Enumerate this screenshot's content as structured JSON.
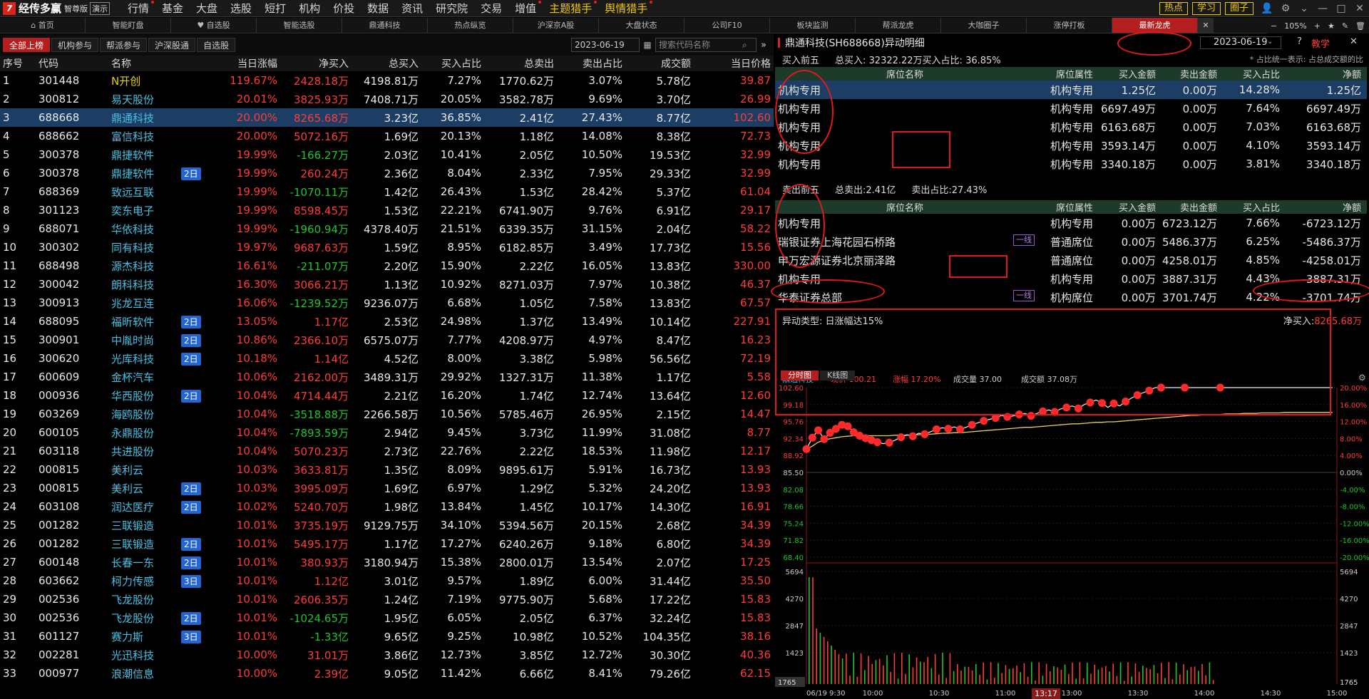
{
  "app": {
    "logo": "经传多赢",
    "edition": "智尊版",
    "demo": "演示"
  },
  "menu": [
    "行情",
    "基金",
    "大盘",
    "选股",
    "短打",
    "机构",
    "价投",
    "数据",
    "资讯",
    "研究院",
    "交易",
    "增值",
    "主题猎手",
    "舆情猎手"
  ],
  "top_right": {
    "hot": "热点",
    "learn": "学习",
    "circle": "圈子"
  },
  "tabs": [
    "首页",
    "智能盯盘",
    "自选股",
    "智能选股",
    "鼎通科技",
    "热点纵览",
    "沪深京A股",
    "大盘状态",
    "公司F10",
    "板块监测",
    "帮派龙虎",
    "大咖圈子",
    "涨停打板",
    "最新龙虎"
  ],
  "tab_ctl": {
    "zoom": "105%"
  },
  "filters": [
    "全部上榜",
    "机构参与",
    "帮派参与",
    "沪深股通",
    "自选股"
  ],
  "left_date": "2023-06-19",
  "search_placeholder": "搜索代码名称",
  "left_headers": [
    "序号",
    "代码",
    "名称",
    "",
    "当日涨幅",
    "净买入",
    "总买入",
    "买入占比",
    "总卖出",
    "卖出占比",
    "成交额",
    "当日价格"
  ],
  "rows": [
    [
      "1",
      "301448",
      "N开创",
      "",
      "119.67%",
      "2428.18万",
      "4198.81万",
      "7.27%",
      "1770.62万",
      "3.07%",
      "5.78亿",
      "39.87"
    ],
    [
      "2",
      "300812",
      "易天股份",
      "",
      "20.01%",
      "3825.93万",
      "7408.71万",
      "20.05%",
      "3582.78万",
      "9.69%",
      "3.70亿",
      "26.99"
    ],
    [
      "3",
      "688668",
      "鼎通科技",
      "",
      "20.00%",
      "8265.68万",
      "3.23亿",
      "36.85%",
      "2.41亿",
      "27.43%",
      "8.77亿",
      "102.60"
    ],
    [
      "4",
      "688662",
      "富信科技",
      "",
      "20.00%",
      "5072.16万",
      "1.69亿",
      "20.13%",
      "1.18亿",
      "14.08%",
      "8.38亿",
      "72.73"
    ],
    [
      "5",
      "300378",
      "鼎捷软件",
      "",
      "19.99%",
      "-166.27万",
      "2.03亿",
      "10.41%",
      "2.05亿",
      "10.50%",
      "19.53亿",
      "32.99"
    ],
    [
      "6",
      "300378",
      "鼎捷软件",
      "2日",
      "19.99%",
      "260.24万",
      "2.36亿",
      "8.04%",
      "2.33亿",
      "7.95%",
      "29.33亿",
      "32.99"
    ],
    [
      "7",
      "688369",
      "致远互联",
      "",
      "19.99%",
      "-1070.11万",
      "1.42亿",
      "26.43%",
      "1.53亿",
      "28.42%",
      "5.37亿",
      "61.04"
    ],
    [
      "8",
      "301123",
      "奕东电子",
      "",
      "19.99%",
      "8598.45万",
      "1.53亿",
      "22.21%",
      "6741.90万",
      "9.76%",
      "6.91亿",
      "29.17"
    ],
    [
      "9",
      "688071",
      "华依科技",
      "",
      "19.99%",
      "-1960.94万",
      "4378.40万",
      "21.51%",
      "6339.35万",
      "31.15%",
      "2.04亿",
      "58.22"
    ],
    [
      "10",
      "300302",
      "同有科技",
      "",
      "19.97%",
      "9687.63万",
      "1.59亿",
      "8.95%",
      "6182.85万",
      "3.49%",
      "17.73亿",
      "15.56"
    ],
    [
      "11",
      "688498",
      "源杰科技",
      "",
      "16.61%",
      "-211.07万",
      "2.20亿",
      "15.90%",
      "2.22亿",
      "16.05%",
      "13.83亿",
      "330.00"
    ],
    [
      "12",
      "300042",
      "朗科科技",
      "",
      "16.30%",
      "3066.21万",
      "1.13亿",
      "10.92%",
      "8271.03万",
      "7.97%",
      "10.38亿",
      "46.37"
    ],
    [
      "13",
      "300913",
      "兆龙互连",
      "",
      "16.06%",
      "-1239.52万",
      "9236.07万",
      "6.68%",
      "1.05亿",
      "7.58%",
      "13.83亿",
      "67.57"
    ],
    [
      "14",
      "688095",
      "福昕软件",
      "2日",
      "13.05%",
      "1.17亿",
      "2.53亿",
      "24.98%",
      "1.37亿",
      "13.49%",
      "10.14亿",
      "227.91"
    ],
    [
      "15",
      "300901",
      "中胤时尚",
      "2日",
      "10.86%",
      "2366.10万",
      "6575.07万",
      "7.77%",
      "4208.97万",
      "4.97%",
      "8.47亿",
      "16.23"
    ],
    [
      "16",
      "300620",
      "光库科技",
      "2日",
      "10.18%",
      "1.14亿",
      "4.52亿",
      "8.00%",
      "3.38亿",
      "5.98%",
      "56.56亿",
      "72.19"
    ],
    [
      "17",
      "600609",
      "金杯汽车",
      "",
      "10.06%",
      "2162.00万",
      "3489.31万",
      "29.92%",
      "1327.31万",
      "11.38%",
      "1.17亿",
      "5.58"
    ],
    [
      "18",
      "000936",
      "华西股份",
      "2日",
      "10.04%",
      "4714.44万",
      "2.21亿",
      "16.20%",
      "1.74亿",
      "12.74%",
      "13.64亿",
      "12.60"
    ],
    [
      "19",
      "603269",
      "海鸥股份",
      "",
      "10.04%",
      "-3518.88万",
      "2266.58万",
      "10.56%",
      "5785.46万",
      "26.95%",
      "2.15亿",
      "14.47"
    ],
    [
      "20",
      "600105",
      "永鼎股份",
      "",
      "10.04%",
      "-7893.59万",
      "2.94亿",
      "9.45%",
      "3.73亿",
      "11.99%",
      "31.08亿",
      "8.77"
    ],
    [
      "21",
      "603118",
      "共进股份",
      "",
      "10.04%",
      "5070.23万",
      "2.73亿",
      "22.76%",
      "2.22亿",
      "18.53%",
      "11.98亿",
      "12.17"
    ],
    [
      "22",
      "000815",
      "美利云",
      "",
      "10.03%",
      "3633.81万",
      "1.35亿",
      "8.09%",
      "9895.61万",
      "5.91%",
      "16.73亿",
      "13.93"
    ],
    [
      "23",
      "000815",
      "美利云",
      "2日",
      "10.03%",
      "3995.09万",
      "1.69亿",
      "6.97%",
      "1.29亿",
      "5.32%",
      "24.20亿",
      "13.93"
    ],
    [
      "24",
      "603108",
      "润达医疗",
      "2日",
      "10.02%",
      "5240.70万",
      "1.98亿",
      "13.84%",
      "1.45亿",
      "10.17%",
      "14.30亿",
      "16.91"
    ],
    [
      "25",
      "001282",
      "三联锻造",
      "",
      "10.01%",
      "3735.19万",
      "9129.75万",
      "34.10%",
      "5394.56万",
      "20.15%",
      "2.68亿",
      "34.39"
    ],
    [
      "26",
      "001282",
      "三联锻造",
      "2日",
      "10.01%",
      "5495.17万",
      "1.17亿",
      "17.27%",
      "6240.26万",
      "9.18%",
      "6.80亿",
      "34.39"
    ],
    [
      "27",
      "600148",
      "长春一东",
      "2日",
      "10.01%",
      "380.93万",
      "3180.94万",
      "15.38%",
      "2800.01万",
      "13.54%",
      "2.07亿",
      "17.25"
    ],
    [
      "28",
      "603662",
      "柯力传感",
      "3日",
      "10.01%",
      "1.12亿",
      "3.01亿",
      "9.57%",
      "1.89亿",
      "6.00%",
      "31.44亿",
      "35.50"
    ],
    [
      "29",
      "002536",
      "飞龙股份",
      "",
      "10.01%",
      "2606.35万",
      "1.24亿",
      "7.19%",
      "9775.90万",
      "5.68%",
      "17.22亿",
      "15.83"
    ],
    [
      "30",
      "002536",
      "飞龙股份",
      "2日",
      "10.01%",
      "-1024.65万",
      "1.95亿",
      "6.05%",
      "2.05亿",
      "6.37%",
      "32.24亿",
      "15.83"
    ],
    [
      "31",
      "601127",
      "赛力斯",
      "3日",
      "10.01%",
      "-1.33亿",
      "9.65亿",
      "9.25%",
      "10.98亿",
      "10.52%",
      "104.35亿",
      "38.16"
    ],
    [
      "32",
      "002281",
      "光迅科技",
      "",
      "10.00%",
      "31.01万",
      "3.86亿",
      "12.73%",
      "3.85亿",
      "12.72%",
      "30.30亿",
      "40.36"
    ],
    [
      "33",
      "000977",
      "浪潮信息",
      "",
      "10.00%",
      "2.39亿",
      "9.05亿",
      "11.42%",
      "6.66亿",
      "8.41%",
      "79.26亿",
      "62.15"
    ]
  ],
  "detail": {
    "title": "鼎通科技(SH688668)异动明细",
    "date": "2023-06-19",
    "teach": "教学",
    "buy_label": "买入前五",
    "buy_total": "总买入: 32322.22万买入占比: 36.85%",
    "note": "* 占比统一表示: 占总成交额的比",
    "headers": [
      "席位名称",
      "席位属性",
      "买入金额",
      "卖出金额",
      "买入占比",
      "净额"
    ],
    "buy_rows": [
      [
        "机构专用",
        "",
        "机构专用",
        "1.25亿",
        "0.00万",
        "14.28%",
        "1.25亿"
      ],
      [
        "机构专用",
        "",
        "机构专用",
        "6697.49万",
        "0.00万",
        "7.64%",
        "6697.49万"
      ],
      [
        "机构专用",
        "",
        "机构专用",
        "6163.68万",
        "0.00万",
        "7.03%",
        "6163.68万"
      ],
      [
        "机构专用",
        "",
        "机构专用",
        "3593.14万",
        "0.00万",
        "4.10%",
        "3593.14万"
      ],
      [
        "机构专用",
        "",
        "机构专用",
        "3340.18万",
        "0.00万",
        "3.81%",
        "3340.18万"
      ]
    ],
    "sell_label": "卖出前五",
    "sell_total": "总卖出:2.41亿",
    "sell_ratio": "卖出占比:27.43%",
    "sell_rows": [
      [
        "机构专用",
        "",
        "机构专用",
        "0.00万",
        "6723.12万",
        "7.66%",
        "-6723.12万"
      ],
      [
        "瑞银证券上海花园石桥路",
        "一线",
        "普通席位",
        "0.00万",
        "5486.37万",
        "6.25%",
        "-5486.37万"
      ],
      [
        "申万宏源证券北京丽泽路",
        "",
        "普通席位",
        "0.00万",
        "4258.01万",
        "4.85%",
        "-4258.01万"
      ],
      [
        "机构专用",
        "",
        "机构专用",
        "0.00万",
        "3887.31万",
        "4.43%",
        "-3887.31万"
      ],
      [
        "华泰证券总部",
        "一线",
        "机构席位",
        "0.00万",
        "3701.74万",
        "4.22%",
        "-3701.74万"
      ]
    ],
    "anomaly": "异动类型: 日涨幅达15%",
    "net_buy_label": "净买入: ",
    "net_buy": "8265.68万"
  },
  "chart_tabs": [
    "分时图",
    "K线图"
  ],
  "chart_info": {
    "name": "鼎通科技",
    "price_label": "现价 100.21",
    "change_label": "涨幅 17.20%",
    "vol_label": "成交量 37.00",
    "amt_label": "成交额 37.08万"
  },
  "chart_data": {
    "type": "line",
    "title": "",
    "price_ticks": [
      "102.60",
      "99.18",
      "95.76",
      "92.34",
      "88.92",
      "85.50",
      "82.08",
      "78.66",
      "75.24",
      "71.82",
      "68.40"
    ],
    "pct_ticks": [
      "20.00%",
      "16.00%",
      "12.00%",
      "8.00%",
      "4.00%",
      "0.00%",
      "-4.00%",
      "-8.00%",
      "-12.00%",
      "-16.00%",
      "-20.00%"
    ],
    "vol_ticks": [
      "5694",
      "4270",
      "2847",
      "1423",
      "1765"
    ],
    "time_ticks": [
      "06/19 9:30",
      "10:00",
      "10:30",
      "11:00",
      "13:00",
      "13:30",
      "14:00",
      "14:30",
      "15:00"
    ],
    "cursor_time": "13:17",
    "ylim": [
      68.4,
      102.6
    ],
    "price": [
      90.2,
      92.5,
      94.0,
      92.2,
      93.5,
      94.3,
      95.1,
      94.8,
      93.6,
      92.9,
      92.4,
      92.0,
      91.6,
      91.3,
      91.5,
      92.0,
      92.6,
      93.1,
      92.8,
      93.4,
      93.2,
      93.7,
      94.2,
      94.5,
      94.3,
      94.7,
      94.2,
      94.6,
      95.1,
      95.5,
      95.9,
      96.2,
      96.5,
      97.0,
      96.7,
      96.9,
      97.2,
      97.4,
      96.9,
      97.4,
      97.8,
      98.1,
      97.7,
      98.3,
      98.6,
      98.9,
      98.4,
      99.2,
      99.6,
      100.1,
      99.5,
      98.6,
      99.4,
      98.9,
      99.8,
      100.5,
      101.1,
      101.6,
      102.0,
      102.6,
      102.6,
      102.6,
      102.6,
      102.6,
      102.6,
      102.6,
      102.6,
      102.6,
      102.6,
      102.6,
      102.6,
      102.6,
      102.6,
      102.6,
      102.6,
      102.6,
      102.6,
      102.6,
      102.6,
      102.6,
      102.6,
      102.6,
      102.6,
      102.6,
      102.6,
      102.6,
      102.6,
      102.6,
      102.6,
      102.6
    ],
    "avg": [
      90.2,
      90.8,
      91.6,
      92.0,
      92.3,
      92.5,
      92.7,
      92.8,
      92.9,
      92.9,
      92.9,
      92.9,
      92.9,
      92.9,
      92.9,
      93.0,
      93.0,
      93.0,
      93.1,
      93.1,
      93.2,
      93.2,
      93.3,
      93.4,
      93.4,
      93.5,
      93.5,
      93.6,
      93.7,
      93.8,
      93.9,
      94.0,
      94.1,
      94.2,
      94.3,
      94.4,
      94.5,
      94.6,
      94.6,
      94.7,
      94.8,
      94.9,
      95.0,
      95.1,
      95.2,
      95.3,
      95.3,
      95.4,
      95.5,
      95.6,
      95.6,
      95.7,
      95.7,
      95.8,
      95.9,
      96.0,
      96.1,
      96.2,
      96.3,
      96.4,
      96.5,
      96.6,
      96.7,
      96.8,
      96.9,
      97.0,
      97.0,
      97.1,
      97.1,
      97.2,
      97.2,
      97.3,
      97.3,
      97.3,
      97.4,
      97.4,
      97.4,
      97.5,
      97.5,
      97.5,
      97.5,
      97.6,
      97.6,
      97.6,
      97.6,
      97.6,
      97.6,
      97.6,
      97.6,
      97.6
    ]
  }
}
